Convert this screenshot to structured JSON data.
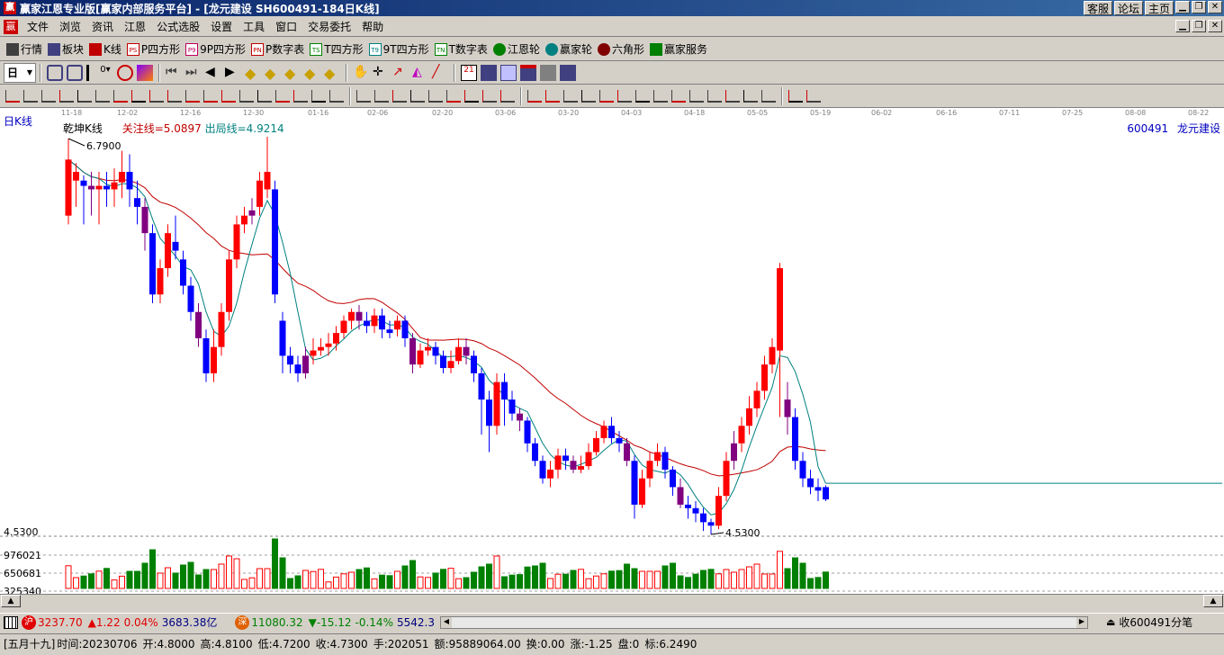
{
  "window": {
    "title": "赢家江恩专业版[赢家内部服务平台] - [龙元建设   SH600491-184日K线]",
    "links": [
      "客服",
      "论坛",
      "主页"
    ]
  },
  "menu": [
    "文件",
    "浏览",
    "资讯",
    "江恩",
    "公式选股",
    "设置",
    "工具",
    "窗口",
    "交易委托",
    "帮助"
  ],
  "toolbar1": [
    {
      "label": "行情",
      "icon": "quote-grid-icon",
      "color": "#404040"
    },
    {
      "label": "板块",
      "icon": "sector-icon",
      "color": "#404080"
    },
    {
      "label": "K线",
      "icon": "kline-icon",
      "color": "#c00000"
    },
    {
      "label": "P四方形",
      "icon": "P4-square-icon",
      "badge": "PS",
      "color": "#c00000"
    },
    {
      "label": "9P四方形",
      "icon": "9P-square-icon",
      "badge": "P9",
      "color": "#c00060"
    },
    {
      "label": "P数字表",
      "icon": "P-number-table-icon",
      "badge": "PN",
      "color": "#c00000"
    },
    {
      "label": "T四方形",
      "icon": "T4-square-icon",
      "badge": "TS",
      "color": "#008000"
    },
    {
      "label": "9T四方形",
      "icon": "9T-square-icon",
      "badge": "T9",
      "color": "#008080"
    },
    {
      "label": "T数字表",
      "icon": "T-number-table-icon",
      "badge": "TN",
      "color": "#008000"
    },
    {
      "label": "江恩轮",
      "icon": "gann-wheel-icon",
      "color": "#008000"
    },
    {
      "label": "赢家轮",
      "icon": "winner-wheel-icon",
      "color": "#008080"
    },
    {
      "label": "六角形",
      "icon": "hexagon-icon",
      "color": "#800000"
    },
    {
      "label": "赢家服务",
      "icon": "dollar-service-icon",
      "color": "#008000"
    }
  ],
  "chart_meta": {
    "period_label": "日K线",
    "indicator_name": "乾坤K线",
    "focus_line": "关注线=5.0897",
    "exit_line": "出局线=4.9214",
    "stock_code": "600491",
    "stock_name": "龙元建设",
    "high_label": "6.7900",
    "low_label": "4.5300",
    "y_price_label": "4.5300",
    "vol_labels": [
      "976021",
      "650681",
      "325340"
    ]
  },
  "date_axis": [
    "11-18",
    "12-02",
    "12-16",
    "12-30",
    "01-16",
    "02-06",
    "02-20",
    "03-06",
    "03-20",
    "04-03",
    "04-18",
    "05-05",
    "05-19",
    "06-02",
    "06-16",
    "07-11",
    "07-25",
    "08-08",
    "08-22"
  ],
  "status": {
    "sh_badge": "沪",
    "sh_index": "3237.70",
    "sh_change": "▲1.22",
    "sh_pct": "0.04%",
    "sh_amount": "3683.38亿",
    "sz_badge": "深",
    "sz_index": "11080.32",
    "sz_change": "▼-15.12",
    "sz_pct": "-0.14%",
    "sz_amount": "5542.3",
    "right_text": "收600491分笔"
  },
  "info": {
    "date_cn": "[五月十九]",
    "time": "时间:20230706",
    "open": "开:4.8000",
    "high": "高:4.8100",
    "low": "低:4.7200",
    "close": "收:4.7300",
    "hands": "手:202051",
    "amount": "额:95889064.00",
    "turnover": "换:0.00",
    "change": "涨:-1.25",
    "pan": "盘:0",
    "mark": "标:6.2490"
  },
  "chart_data": {
    "type": "candlestick",
    "period": "日K线",
    "ylim": [
      4.53,
      6.79
    ],
    "price_marks": {
      "high": 6.79,
      "low": 4.53
    },
    "series": [
      {
        "name": "关注线",
        "value": 5.0897
      },
      {
        "name": "出局线",
        "value": 4.9214
      }
    ],
    "candles": [
      [
        6.35,
        6.67,
        6.79,
        6.3
      ],
      [
        6.55,
        6.6,
        6.65,
        6.4
      ],
      [
        6.55,
        6.52,
        6.58,
        6.3
      ],
      [
        6.52,
        6.5,
        6.6,
        6.35
      ],
      [
        6.5,
        6.52,
        6.6,
        6.3
      ],
      [
        6.52,
        6.5,
        6.6,
        6.4
      ],
      [
        6.5,
        6.54,
        6.62,
        6.4
      ],
      [
        6.54,
        6.6,
        6.72,
        6.45
      ],
      [
        6.6,
        6.5,
        6.7,
        6.4
      ],
      [
        6.45,
        6.4,
        6.55,
        6.3
      ],
      [
        6.4,
        6.25,
        6.45,
        6.15
      ],
      [
        6.25,
        5.9,
        6.3,
        5.85
      ],
      [
        5.9,
        6.05,
        6.1,
        5.85
      ],
      [
        6.05,
        6.25,
        6.3,
        6.0
      ],
      [
        6.2,
        6.15,
        6.35,
        6.1
      ],
      [
        6.1,
        5.95,
        6.15,
        5.9
      ],
      [
        5.95,
        5.8,
        6.0,
        5.75
      ],
      [
        5.8,
        5.65,
        5.85,
        5.6
      ],
      [
        5.65,
        5.45,
        5.7,
        5.4
      ],
      [
        5.45,
        5.6,
        5.7,
        5.4
      ],
      [
        5.6,
        5.8,
        5.85,
        5.55
      ],
      [
        5.8,
        6.1,
        6.15,
        5.75
      ],
      [
        6.1,
        6.3,
        6.35,
        6.05
      ],
      [
        6.3,
        6.35,
        6.4,
        6.25
      ],
      [
        6.35,
        6.38,
        6.45,
        6.3
      ],
      [
        6.4,
        6.55,
        6.6,
        6.35
      ],
      [
        6.5,
        6.6,
        6.8,
        6.45
      ],
      [
        6.5,
        5.9,
        6.55,
        5.85
      ],
      [
        5.75,
        5.55,
        5.8,
        5.45
      ],
      [
        5.55,
        5.5,
        5.6,
        5.45
      ],
      [
        5.5,
        5.45,
        5.55,
        5.4
      ],
      [
        5.45,
        5.55,
        5.6,
        5.42
      ],
      [
        5.55,
        5.58,
        5.65,
        5.5
      ],
      [
        5.58,
        5.6,
        5.65,
        5.55
      ],
      [
        5.6,
        5.62,
        5.68,
        5.55
      ],
      [
        5.62,
        5.68,
        5.72,
        5.58
      ],
      [
        5.68,
        5.75,
        5.78,
        5.65
      ],
      [
        5.75,
        5.8,
        5.82,
        5.7
      ],
      [
        5.8,
        5.75,
        5.84,
        5.7
      ],
      [
        5.75,
        5.72,
        5.8,
        5.68
      ],
      [
        5.72,
        5.78,
        5.82,
        5.68
      ],
      [
        5.78,
        5.7,
        5.82,
        5.65
      ],
      [
        5.7,
        5.68,
        5.75,
        5.65
      ],
      [
        5.7,
        5.75,
        5.78,
        5.66
      ],
      [
        5.75,
        5.65,
        5.78,
        5.6
      ],
      [
        5.65,
        5.5,
        5.68,
        5.45
      ],
      [
        5.5,
        5.58,
        5.62,
        5.48
      ],
      [
        5.58,
        5.6,
        5.65,
        5.55
      ],
      [
        5.6,
        5.55,
        5.63,
        5.5
      ],
      [
        5.55,
        5.48,
        5.58,
        5.45
      ],
      [
        5.48,
        5.52,
        5.58,
        5.45
      ],
      [
        5.52,
        5.6,
        5.65,
        5.5
      ],
      [
        5.6,
        5.55,
        5.65,
        5.5
      ],
      [
        5.55,
        5.45,
        5.58,
        5.4
      ],
      [
        5.45,
        5.3,
        5.48,
        5.1
      ],
      [
        5.3,
        5.15,
        5.35,
        5.0
      ],
      [
        5.15,
        5.4,
        5.45,
        5.1
      ],
      [
        5.4,
        5.3,
        5.45,
        5.15
      ],
      [
        5.3,
        5.22,
        5.35,
        5.18
      ],
      [
        5.22,
        5.18,
        5.25,
        5.12
      ],
      [
        5.18,
        5.05,
        5.2,
        5.0
      ],
      [
        5.05,
        4.95,
        5.08,
        4.92
      ],
      [
        4.95,
        4.85,
        4.98,
        4.82
      ],
      [
        4.85,
        4.9,
        4.95,
        4.8
      ],
      [
        4.9,
        4.98,
        5.02,
        4.85
      ],
      [
        4.98,
        4.95,
        5.02,
        4.9
      ],
      [
        4.95,
        4.9,
        4.98,
        4.88
      ],
      [
        4.9,
        4.92,
        4.98,
        4.88
      ],
      [
        4.92,
        5.0,
        5.05,
        4.9
      ],
      [
        5.0,
        5.08,
        5.12,
        4.98
      ],
      [
        5.08,
        5.15,
        5.18,
        5.05
      ],
      [
        5.15,
        5.08,
        5.2,
        5.05
      ],
      [
        5.08,
        5.05,
        5.12,
        5.0
      ],
      [
        5.05,
        4.95,
        5.08,
        4.92
      ],
      [
        4.95,
        4.7,
        4.98,
        4.62
      ],
      [
        4.7,
        4.85,
        4.9,
        4.68
      ],
      [
        4.85,
        4.95,
        5.0,
        4.8
      ],
      [
        4.95,
        5.0,
        5.05,
        4.92
      ],
      [
        5.0,
        4.9,
        5.03,
        4.85
      ],
      [
        4.9,
        4.8,
        4.92,
        4.75
      ],
      [
        4.8,
        4.7,
        4.85,
        4.68
      ],
      [
        4.7,
        4.68,
        4.75,
        4.62
      ],
      [
        4.68,
        4.65,
        4.72,
        4.6
      ],
      [
        4.65,
        4.6,
        4.68,
        4.55
      ],
      [
        4.6,
        4.58,
        4.62,
        4.53
      ],
      [
        4.58,
        4.75,
        4.8,
        4.56
      ],
      [
        4.75,
        4.95,
        5.0,
        4.72
      ],
      [
        4.95,
        5.05,
        5.12,
        4.9
      ],
      [
        5.05,
        5.15,
        5.2,
        5.0
      ],
      [
        5.15,
        5.25,
        5.32,
        5.1
      ],
      [
        5.25,
        5.35,
        5.4,
        5.2
      ],
      [
        5.35,
        5.5,
        5.55,
        5.3
      ],
      [
        5.5,
        5.6,
        5.65,
        5.45
      ],
      [
        5.58,
        6.05,
        6.08,
        5.2
      ],
      [
        5.3,
        5.2,
        5.4,
        5.1
      ],
      [
        5.2,
        4.95,
        5.25,
        4.9
      ],
      [
        4.95,
        4.85,
        5.0,
        4.8
      ],
      [
        4.85,
        4.8,
        4.9,
        4.76
      ],
      [
        4.8,
        4.78,
        4.85,
        4.72
      ],
      [
        4.8,
        4.73,
        4.81,
        4.72
      ]
    ]
  }
}
